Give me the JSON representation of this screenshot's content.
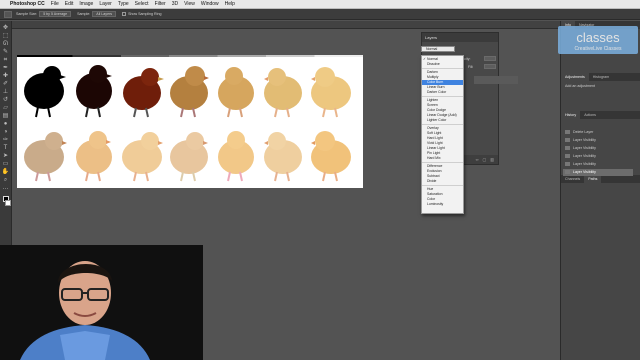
{
  "menubar": {
    "app": "Photoshop CC",
    "items": [
      "File",
      "Edit",
      "Image",
      "Layer",
      "Type",
      "Select",
      "Filter",
      "3D",
      "View",
      "Window",
      "Help"
    ]
  },
  "options": {
    "sample_label": "Sample Size:",
    "sample_value": "5 by 5 Average",
    "sample_label2": "Sample:",
    "sample_value2": "All Layers",
    "show_ring": "Show Sampling Ring"
  },
  "layers_panel": {
    "title": "Layers",
    "mode_value": "Normal",
    "opacity_label": "Opacity:",
    "opacity_value": "100%",
    "fill_label": "Fill:",
    "fill_value": "100%"
  },
  "blend_modes": [
    [
      "Normal",
      "Dissolve"
    ],
    [
      "Darken",
      "Multiply",
      "Color Burn",
      "Linear Burn",
      "Darker Color"
    ],
    [
      "Lighten",
      "Screen",
      "Color Dodge",
      "Linear Dodge (Add)",
      "Lighter Color"
    ],
    [
      "Overlay",
      "Soft Light",
      "Hard Light",
      "Vivid Light",
      "Linear Light",
      "Pin Light",
      "Hard Mix"
    ],
    [
      "Difference",
      "Exclusion",
      "Subtract",
      "Divide"
    ],
    [
      "Hue",
      "Saturation",
      "Color",
      "Luminosity"
    ]
  ],
  "blend_selected": "Color Burn",
  "blend_checked": "Normal",
  "dock": {
    "top_tabs": [
      "Info",
      "Navigator"
    ],
    "adj_tabs": [
      "Adjustments",
      "Histogram"
    ],
    "adj_hint": "Add an adjustment",
    "history_tabs": [
      "History",
      "Actions"
    ],
    "history_items": [
      "Delete Layer",
      "Layer Visibility",
      "Layer Visibility",
      "Layer Visibility",
      "Layer Visibility",
      "Layer Visibility"
    ],
    "bottom_tabs": [
      "Channels",
      "Paths"
    ]
  },
  "watermark": {
    "big": "classes",
    "small": "CreativeLive Classes"
  },
  "colors": {
    "accent": "#3f83e0",
    "panel": "#464646",
    "workspace": "#535353"
  }
}
